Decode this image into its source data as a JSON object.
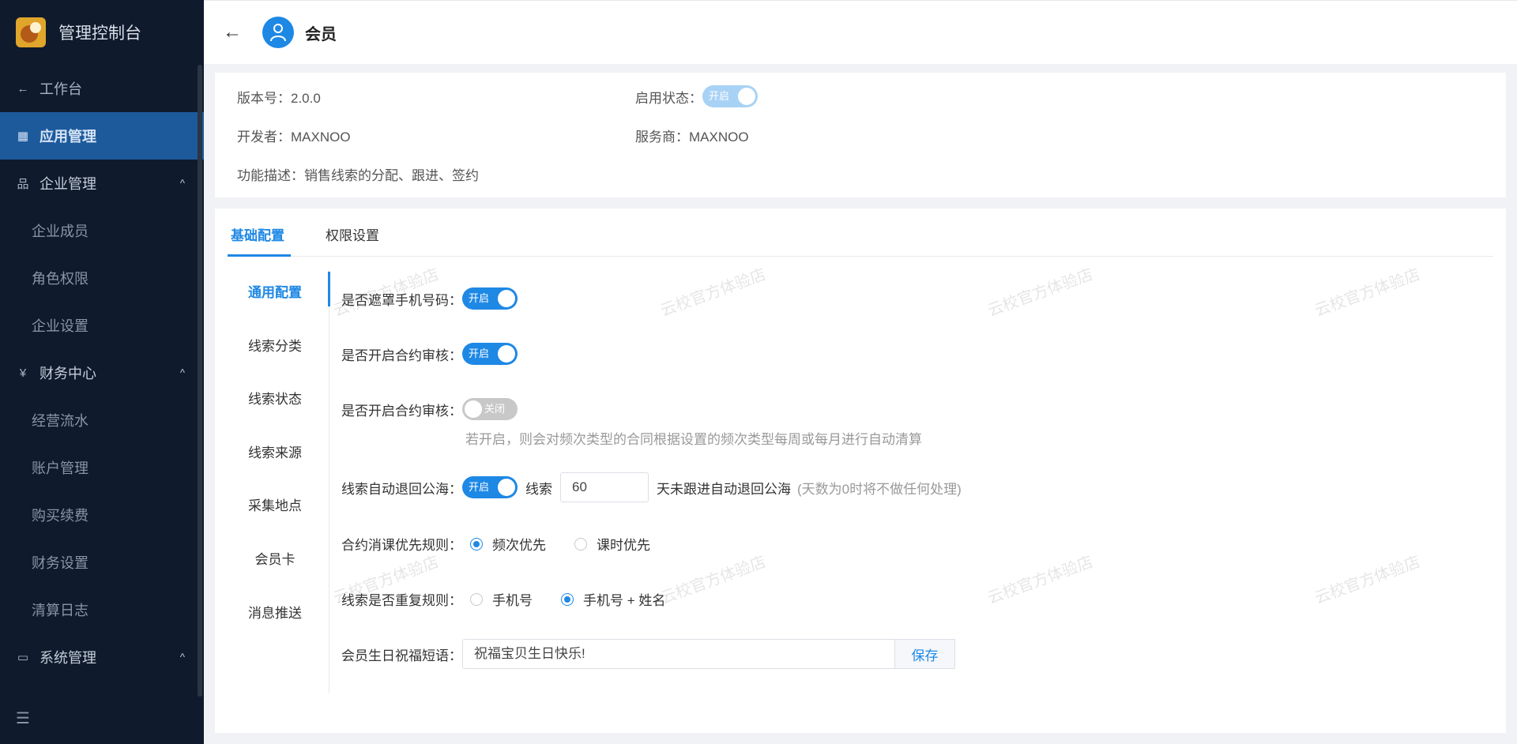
{
  "app": {
    "title": "管理控制台"
  },
  "sidebar": {
    "workbench": "工作台",
    "app_manage": "应用管理",
    "groups": [
      {
        "label": "企业管理",
        "items": [
          "企业成员",
          "角色权限",
          "企业设置"
        ]
      },
      {
        "label": "财务中心",
        "items": [
          "经营流水",
          "账户管理",
          "购买续费",
          "财务设置",
          "清算日志"
        ]
      },
      {
        "label": "系统管理",
        "items": []
      }
    ]
  },
  "header": {
    "title": "会员"
  },
  "info": {
    "version": "版本号：2.0.0",
    "status_label": "启用状态：",
    "status_switch": "开启",
    "developer": "开发者：MAXNOO",
    "provider": "服务商：MAXNOO",
    "description": "功能描述：销售线索的分配、跟进、签约"
  },
  "tabs": [
    "基础配置",
    "权限设置"
  ],
  "side_tabs": [
    "通用配置",
    "线索分类",
    "线索状态",
    "线索来源",
    "采集地点",
    "会员卡",
    "消息推送"
  ],
  "form": {
    "mask_phone_label": "是否遮罩手机号码：",
    "mask_phone_switch": "开启",
    "contract_review_label": "是否开启合约审核：",
    "contract_review_switch": "开启",
    "contract_review2_label": "是否开启合约审核：",
    "contract_review2_switch": "关闭",
    "contract_review2_hint": "若开启，则会对频次类型的合同根据设置的频次类型每周或每月进行自动清算",
    "auto_return_label": "线索自动退回公海：",
    "auto_return_switch": "开启",
    "auto_return_prefix": "线索",
    "auto_return_days": "60",
    "auto_return_suffix": "天未跟进自动退回公海",
    "auto_return_hint": "(天数为0时将不做任何处理)",
    "consume_rule_label": "合约消课优先规则：",
    "consume_rule_options": [
      "频次优先",
      "课时优先"
    ],
    "consume_rule_selected": "频次优先",
    "dup_rule_label": "线索是否重复规则：",
    "dup_rule_options": [
      "手机号",
      "手机号 + 姓名"
    ],
    "dup_rule_selected": "手机号 + 姓名",
    "birthday_label": "会员生日祝福短语：",
    "birthday_value": "祝福宝贝生日快乐!",
    "save_label": "保存"
  },
  "watermark": "云校官方体验店",
  "colors": {
    "primary": "#1e88e5",
    "sidebar_bg": "#0f1b2d",
    "active_nav": "#1d5a9c"
  }
}
